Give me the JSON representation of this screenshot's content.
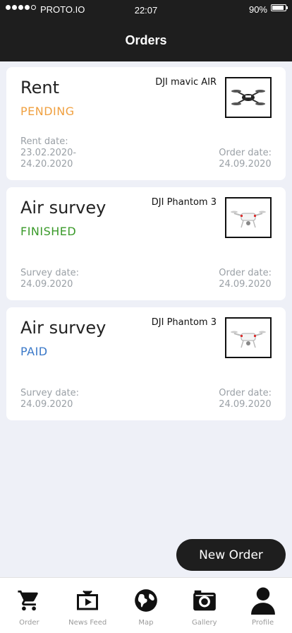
{
  "status_bar": {
    "carrier": "PROTO.IO",
    "time": "22:07",
    "battery": "90%"
  },
  "header": {
    "title": "Orders"
  },
  "orders": [
    {
      "service": "Rent",
      "status": "PENDING",
      "status_color": "#f0a040",
      "drone": "DJI mavic AIR",
      "left_label": "Rent date:",
      "left_value_1": "23.02.2020-",
      "left_value_2": "24.20.2020",
      "right_label": "Order date:",
      "right_value": "24.09.2020",
      "image_icon": "drone-mavic-icon"
    },
    {
      "service": "Air survey",
      "status": "FINISHED",
      "status_color": "#3a9a2a",
      "drone": "DJI Phantom 3",
      "left_label": "Survey date:",
      "left_value_1": "24.09.2020",
      "right_label": "Order date:",
      "right_value": "24.09.2020",
      "image_icon": "drone-phantom-icon"
    },
    {
      "service": "Air survey",
      "status": "PAID",
      "status_color": "#3a78c8",
      "drone": "DJI Phantom 3",
      "left_label": "Survey date:",
      "left_value_1": "24.09.2020",
      "right_label": "Order date:",
      "right_value": "24.09.2020",
      "image_icon": "drone-phantom-icon"
    }
  ],
  "new_order_label": "New Order",
  "tabbar": [
    {
      "label": "Order",
      "icon": "cart-icon"
    },
    {
      "label": "News Feed",
      "icon": "tv-play-icon"
    },
    {
      "label": "Map",
      "icon": "globe-icon"
    },
    {
      "label": "Gallery",
      "icon": "camera-icon"
    },
    {
      "label": "Profile",
      "icon": "person-icon"
    }
  ]
}
